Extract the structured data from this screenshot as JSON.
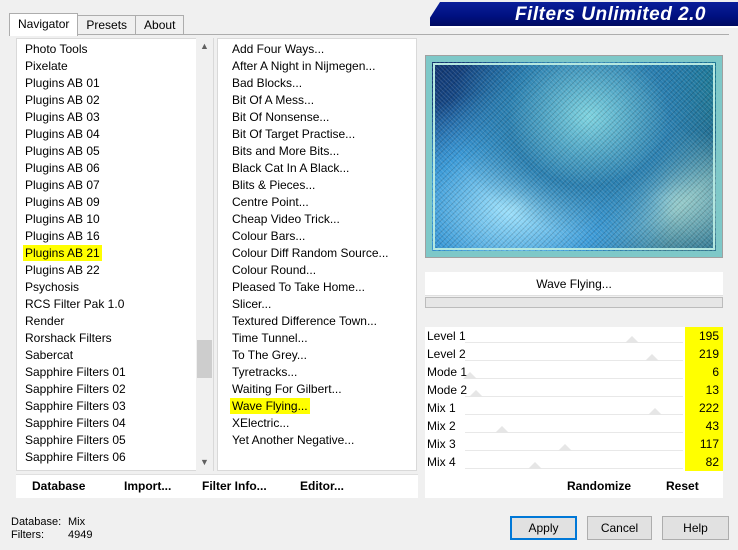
{
  "window": {
    "title": "Filters Unlimited 2.0"
  },
  "tabs": [
    {
      "label": "Navigator",
      "active": true
    },
    {
      "label": "Presets",
      "active": false
    },
    {
      "label": "About",
      "active": false
    }
  ],
  "categories": [
    "Photo Tools",
    "Pixelate",
    "Plugins AB 01",
    "Plugins AB 02",
    "Plugins AB 03",
    "Plugins AB 04",
    "Plugins AB 05",
    "Plugins AB 06",
    "Plugins AB 07",
    "Plugins AB 09",
    "Plugins AB 10",
    "Plugins AB 16",
    "Plugins AB 21",
    "Plugins AB 22",
    "Psychosis",
    "RCS Filter Pak 1.0",
    "Render",
    "Rorshack Filters",
    "Sabercat",
    "Sapphire Filters 01",
    "Sapphire Filters 02",
    "Sapphire Filters 03",
    "Sapphire Filters 04",
    "Sapphire Filters 05",
    "Sapphire Filters 06"
  ],
  "selected_category": "Plugins AB 21",
  "filters": [
    "Add Four Ways...",
    "After A Night in Nijmegen...",
    "Bad Blocks...",
    "Bit Of A Mess...",
    "Bit Of Nonsense...",
    "Bit Of Target Practise...",
    "Bits and More Bits...",
    "Black Cat In A Black...",
    "Blits & Pieces...",
    "Centre Point...",
    "Cheap Video Trick...",
    "Colour Bars...",
    "Colour Diff Random Source...",
    "Colour Round...",
    "Pleased To Take Home...",
    "Slicer...",
    "Textured Difference Town...",
    "Time Tunnel...",
    "To The Grey...",
    "Tyretracks...",
    "Waiting For Gilbert...",
    "Wave Flying...",
    "XElectric...",
    "Yet Another Negative..."
  ],
  "selected_filter": "Wave Flying...",
  "left_buttons": {
    "database": "Database",
    "import": "Import...",
    "filter_info": "Filter Info...",
    "editor": "Editor..."
  },
  "filter_name": "Wave Flying...",
  "sliders": [
    {
      "label": "Level 1",
      "value": "195",
      "level": 0.765
    },
    {
      "label": "Level 2",
      "value": "219",
      "level": 0.859
    },
    {
      "label": "Mode 1",
      "value": "6",
      "level": 0.024
    },
    {
      "label": "Mode 2",
      "value": "13",
      "level": 0.051
    },
    {
      "label": "Mix 1",
      "value": "222",
      "level": 0.871
    },
    {
      "label": "Mix 2",
      "value": "43",
      "level": 0.169
    },
    {
      "label": "Mix 3",
      "value": "117",
      "level": 0.459
    },
    {
      "label": "Mix 4",
      "value": "82",
      "level": 0.322
    }
  ],
  "right_buttons": {
    "randomize": "Randomize",
    "reset": "Reset"
  },
  "status": {
    "database_label": "Database:",
    "database_value": "Mix",
    "filters_label": "Filters:",
    "filters_value": "4949"
  },
  "dialog_buttons": {
    "apply": "Apply",
    "cancel": "Cancel",
    "help": "Help"
  },
  "colors": {
    "highlight": "#ffff00",
    "banner": "#001080",
    "focus": "#0078d7"
  }
}
